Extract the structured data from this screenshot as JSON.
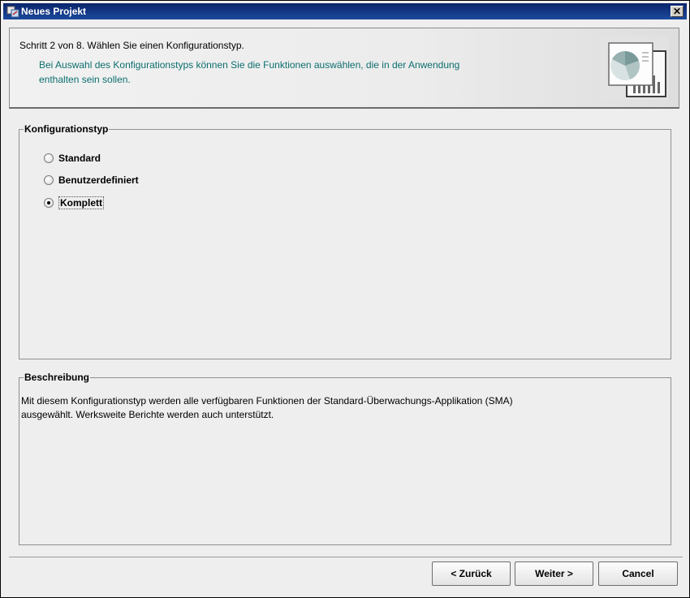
{
  "window": {
    "title": "Neues Projekt"
  },
  "header": {
    "step": "Schritt 2 von 8. Wählen Sie einen Konfigurationstyp.",
    "description": "Bei Auswahl des Konfigurationstyps können Sie die Funktionen auswählen, die in der Anwendung enthalten sein sollen."
  },
  "config_group": {
    "title": "Konfigurationstyp",
    "options": [
      {
        "label": "Standard",
        "checked": false
      },
      {
        "label": "Benutzerdefiniert",
        "checked": false
      },
      {
        "label": "Komplett",
        "checked": true
      }
    ]
  },
  "description_group": {
    "title": "Beschreibung",
    "text_line1": "Mit diesem Konfigurationstyp werden alle verfügbaren Funktionen der Standard-Überwachungs-Applikation (SMA)",
    "text_line2": "ausgewählt. Werksweite Berichte werden auch unterstützt."
  },
  "buttons": {
    "back": "< Zurück",
    "next": "Weiter >",
    "cancel": "Cancel"
  },
  "icons": {
    "app": "application-icon",
    "close": "close-icon",
    "header_graphic": "report-chart-icon"
  }
}
